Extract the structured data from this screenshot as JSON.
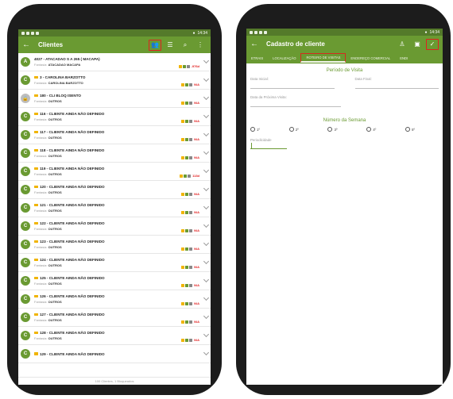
{
  "left": {
    "status": {
      "time": "14:34"
    },
    "appbar": {
      "title": "Clientes",
      "back_icon": "arrow-left-icon"
    },
    "actions": [
      "add-client-icon",
      "filter-icon",
      "search-icon",
      "more-vert-icon"
    ],
    "rows": [
      {
        "avatar": "A",
        "name": "4027 - ATACADAO S A 265 ( MACAPA)",
        "fantasia_label": "Fantasia:",
        "fantasia": "ATACADAO MACAPA",
        "status": "-976d",
        "folder": false
      },
      {
        "avatar": "C",
        "name": "3 - CAROLINA BARZOTTO",
        "fantasia_label": "Fantasia:",
        "fantasia": "CAROLINA BARZOTTO",
        "status": "N/A",
        "folder": true
      },
      {
        "avatar": "",
        "name": "180 - CLI BLOQ ISENTO",
        "fantasia_label": "Fantasia:",
        "fantasia": "OUTROS",
        "status": "N/A",
        "folder": true,
        "locked": true
      },
      {
        "avatar": "C",
        "name": "116 - CLIENTE AINDA NÃO DEFINIDO",
        "fantasia_label": "Fantasia:",
        "fantasia": "OUTROS",
        "status": "N/A",
        "folder": true
      },
      {
        "avatar": "C",
        "name": "117 - CLIENTE AINDA NÃO DEFINIDO",
        "fantasia_label": "Fantasia:",
        "fantasia": "OUTROS",
        "status": "N/A",
        "folder": true
      },
      {
        "avatar": "C",
        "name": "118 - CLIENTE AINDA NÃO DEFINIDO",
        "fantasia_label": "Fantasia:",
        "fantasia": "OUTROS",
        "status": "N/A",
        "folder": true
      },
      {
        "avatar": "C",
        "name": "119 - CLIENTE AINDA NÃO DEFINIDO",
        "fantasia_label": "Fantasia:",
        "fantasia": "OUTROS",
        "status": "113d",
        "folder": true
      },
      {
        "avatar": "C",
        "name": "120 - CLIENTE AINDA NÃO DEFINIDO",
        "fantasia_label": "Fantasia:",
        "fantasia": "OUTROS",
        "status": "N/A",
        "folder": true
      },
      {
        "avatar": "C",
        "name": "121 - CLIENTE AINDA NÃO DEFINIDO",
        "fantasia_label": "Fantasia:",
        "fantasia": "OUTROS",
        "status": "N/A",
        "folder": true
      },
      {
        "avatar": "C",
        "name": "122 - CLIENTE AINDA NÃO DEFINIDO",
        "fantasia_label": "Fantasia:",
        "fantasia": "OUTROS",
        "status": "N/A",
        "folder": true
      },
      {
        "avatar": "C",
        "name": "123 - CLIENTE AINDA NÃO DEFINIDO",
        "fantasia_label": "Fantasia:",
        "fantasia": "OUTROS",
        "status": "N/A",
        "folder": true
      },
      {
        "avatar": "C",
        "name": "124 - CLIENTE AINDA NÃO DEFINIDO",
        "fantasia_label": "Fantasia:",
        "fantasia": "OUTROS",
        "status": "N/A",
        "folder": true
      },
      {
        "avatar": "C",
        "name": "125 - CLIENTE AINDA NÃO DEFINIDO",
        "fantasia_label": "Fantasia:",
        "fantasia": "OUTROS",
        "status": "N/A",
        "folder": true
      },
      {
        "avatar": "C",
        "name": "126 - CLIENTE AINDA NÃO DEFINIDO",
        "fantasia_label": "Fantasia:",
        "fantasia": "OUTROS",
        "status": "N/A",
        "folder": true
      },
      {
        "avatar": "C",
        "name": "127 - CLIENTE AINDA NÃO DEFINIDO",
        "fantasia_label": "Fantasia:",
        "fantasia": "OUTROS",
        "status": "N/A",
        "folder": true
      },
      {
        "avatar": "C",
        "name": "128 - CLIENTE AINDA NÃO DEFINIDO",
        "fantasia_label": "Fantasia:",
        "fantasia": "OUTROS",
        "status": "N/A",
        "folder": true
      },
      {
        "avatar": "C",
        "name": "129 - CLIENTE AINDA NÃO DEFINIDO",
        "fantasia_label": "Fantasia:",
        "fantasia": "",
        "status": "",
        "folder": true
      }
    ],
    "footer": "100 Clientes, 1 Bloqueados"
  },
  "right": {
    "status": {
      "time": "14:34"
    },
    "appbar": {
      "title": "Cadastro de cliente",
      "back_icon": "arrow-left-icon"
    },
    "actions": [
      "person-pin-icon",
      "id-card-icon",
      "check-icon"
    ],
    "tabs": [
      "ETRAIS",
      "LOCALIZAÇÃO",
      "ROTEIRO DE VISITAS",
      "ENDEREÇO COMERCIAL",
      "ENDI"
    ],
    "active_tab": 2,
    "periodo": {
      "title": "Período de Visita",
      "data_inicial": "Data Inicial:",
      "data_final": "Data Final:",
      "data_proxima": "Data da Próxima Visita:"
    },
    "semana": {
      "title": "Número da Semana",
      "options": [
        "1º",
        "2º",
        "3º",
        "4º",
        "5º"
      ]
    },
    "periodicidade": {
      "label": "Periodicidade"
    }
  },
  "colors": {
    "primary": "#6a9a32",
    "dark": "#547a2a",
    "highlight": "#e02020",
    "accent": "#f0b400"
  }
}
